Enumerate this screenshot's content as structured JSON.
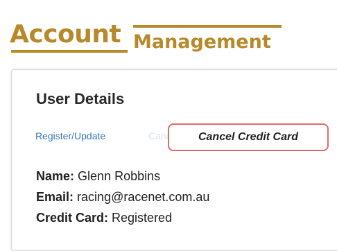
{
  "header": {
    "title_main": "Account",
    "title_sub": "Management"
  },
  "panel": {
    "section_title": "User Details",
    "links": {
      "register_update": "Register/Update",
      "faded_link": "Canc"
    },
    "cancel_button_label": "Cancel Credit  Card",
    "details": [
      {
        "label": "Name:",
        "value": "Glenn Robbins"
      },
      {
        "label": "Email:",
        "value": "racing@racenet.com.au"
      },
      {
        "label": "Credit Card:",
        "value": "Registered"
      }
    ]
  },
  "colors": {
    "brand_gold": "#b8892a",
    "link_blue": "#3a78b8",
    "cancel_border_red": "#e06a6a"
  }
}
